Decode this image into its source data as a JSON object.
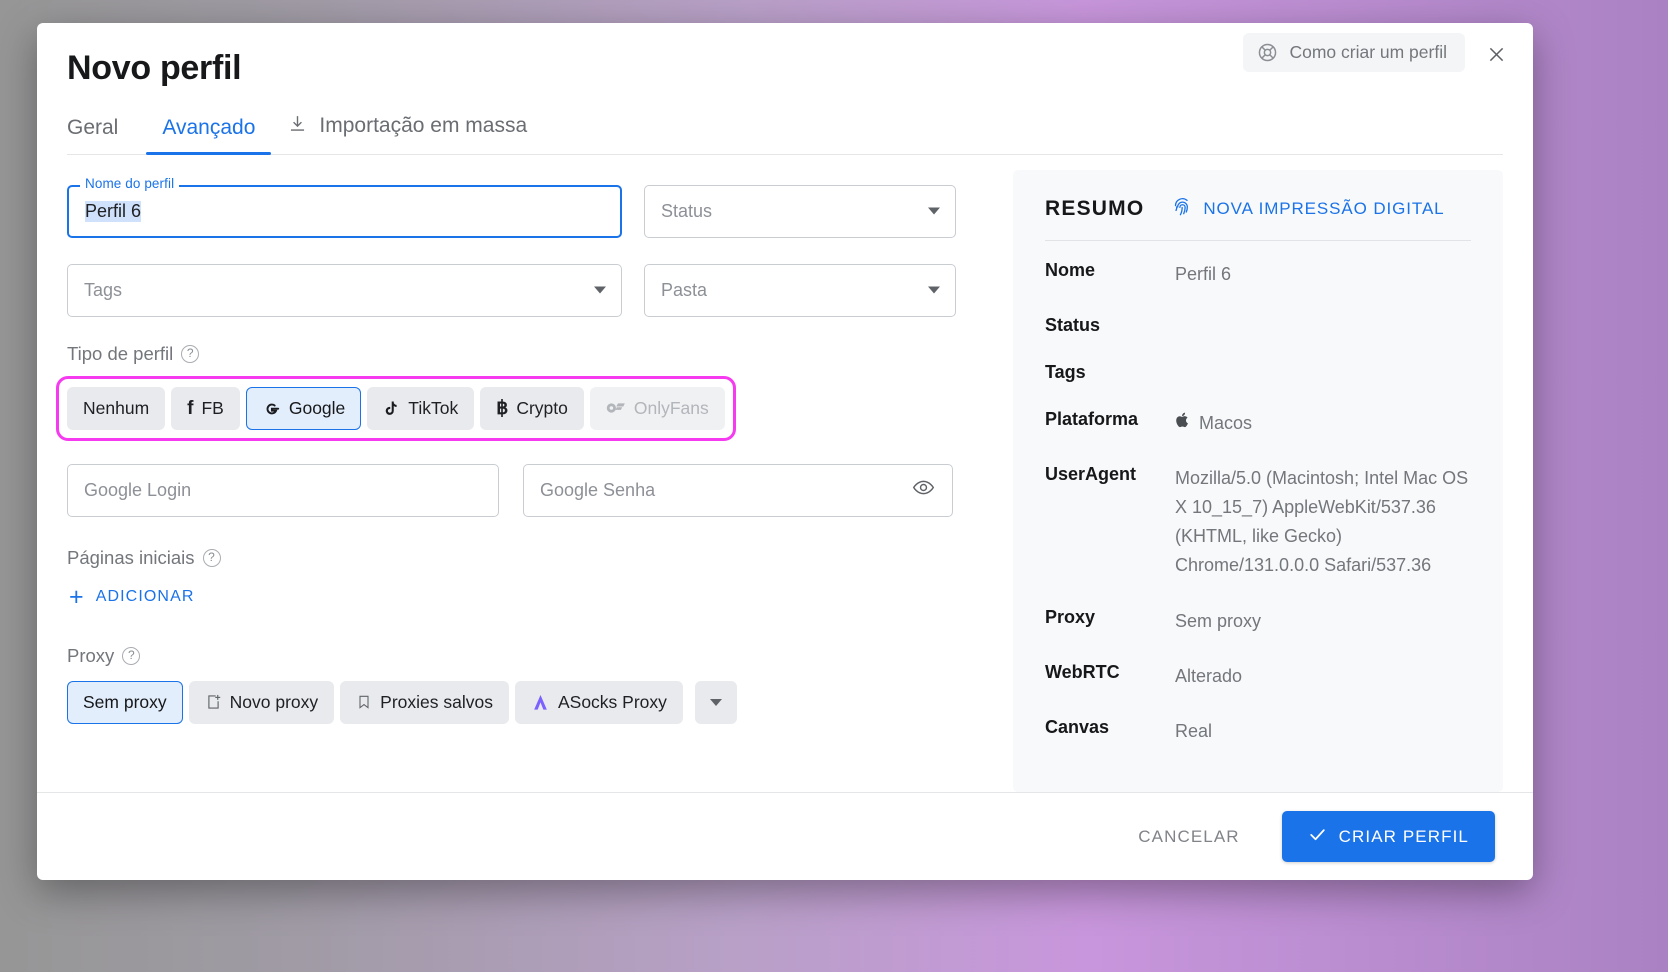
{
  "dialog": {
    "title": "Novo perfil",
    "help_label": "Como criar um perfil",
    "close_label": "×"
  },
  "tabs": [
    {
      "label": "Geral",
      "active": false
    },
    {
      "label": "Avançado",
      "active": true
    },
    {
      "label": "Importação em massa",
      "active": false,
      "icon": "download-icon"
    }
  ],
  "form": {
    "name_field": {
      "legend": "Nome do perfil",
      "value": "Perfil 6",
      "selected": true
    },
    "status_field": {
      "placeholder": "Status"
    },
    "tags_field": {
      "placeholder": "Tags"
    },
    "folder_field": {
      "placeholder": "Pasta"
    },
    "profile_type": {
      "label": "Tipo de perfil",
      "options": [
        {
          "label": "Nenhum",
          "icon": "none",
          "selected": false,
          "disabled": false
        },
        {
          "label": "FB",
          "icon": "facebook-icon",
          "selected": false,
          "disabled": false
        },
        {
          "label": "Google",
          "icon": "google-icon",
          "selected": true,
          "disabled": false
        },
        {
          "label": "TikTok",
          "icon": "tiktok-icon",
          "selected": false,
          "disabled": false
        },
        {
          "label": "Crypto",
          "icon": "bitcoin-icon",
          "selected": false,
          "disabled": false
        },
        {
          "label": "OnlyFans",
          "icon": "onlyfans-icon",
          "selected": false,
          "disabled": true
        }
      ]
    },
    "google_login": {
      "placeholder": "Google Login"
    },
    "google_password": {
      "placeholder": "Google Senha"
    },
    "start_pages": {
      "label": "Páginas iniciais",
      "add_label": "ADICIONAR"
    },
    "proxy": {
      "label": "Proxy",
      "options": [
        {
          "label": "Sem proxy",
          "icon": "none",
          "selected": true
        },
        {
          "label": "Novo proxy",
          "icon": "new-proxy-icon",
          "selected": false
        },
        {
          "label": "Proxies salvos",
          "icon": "bookmark-icon",
          "selected": false
        },
        {
          "label": "ASocks Proxy",
          "icon": "asocks-icon",
          "selected": false
        }
      ]
    }
  },
  "summary": {
    "title": "RESUMO",
    "fingerprint_label": "NOVA IMPRESSÃO DIGITAL",
    "rows": [
      {
        "key": "Nome",
        "value": "Perfil 6",
        "icon": ""
      },
      {
        "key": "Status",
        "value": "",
        "icon": ""
      },
      {
        "key": "Tags",
        "value": "",
        "icon": ""
      },
      {
        "key": "Plataforma",
        "value": "Macos",
        "icon": "apple-icon"
      },
      {
        "key": "UserAgent",
        "value": "Mozilla/5.0 (Macintosh; Intel Mac OS X 10_15_7) AppleWebKit/537.36 (KHTML, like Gecko) Chrome/131.0.0.0 Safari/537.36",
        "icon": ""
      },
      {
        "key": "Proxy",
        "value": "Sem proxy",
        "icon": ""
      },
      {
        "key": "WebRTC",
        "value": "Alterado",
        "icon": ""
      },
      {
        "key": "Canvas",
        "value": "Real",
        "icon": ""
      }
    ]
  },
  "footer": {
    "cancel_label": "CANCELAR",
    "create_label": "CRIAR PERFIL"
  },
  "colors": {
    "accent": "#1a73e8",
    "highlight": "#f63af0",
    "chip_bg": "#e8eaed",
    "panel_bg": "#f8f9fa"
  }
}
